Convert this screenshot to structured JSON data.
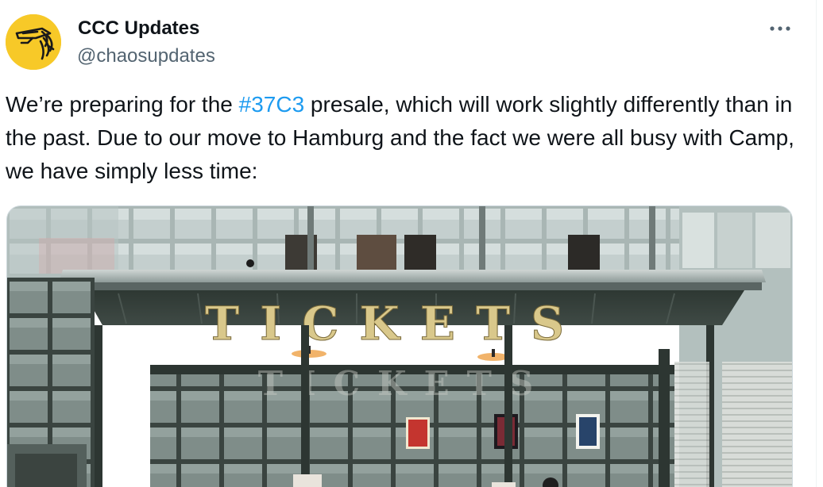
{
  "author": {
    "display_name": "CCC Updates",
    "handle": "@chaosupdates",
    "avatar_icon": "ccc-chaos-knoten-logo-icon",
    "avatar_bg": "#f7c928"
  },
  "actions": {
    "more_icon": "more-horizontal-icon"
  },
  "tweet": {
    "text_before": "We’re preparing for the ",
    "hashtag": "#37C3",
    "text_after": " presale, which will work slightly differently than in the past. Due to our move to Hamburg and the fact we were all busy with Camp, we have simply less time:"
  },
  "media": {
    "sign_text": "TICKETS",
    "reflection_text": "TICKETS"
  },
  "colors": {
    "text": "#0f1419",
    "secondary": "#536471",
    "link": "#1d9bf0"
  }
}
